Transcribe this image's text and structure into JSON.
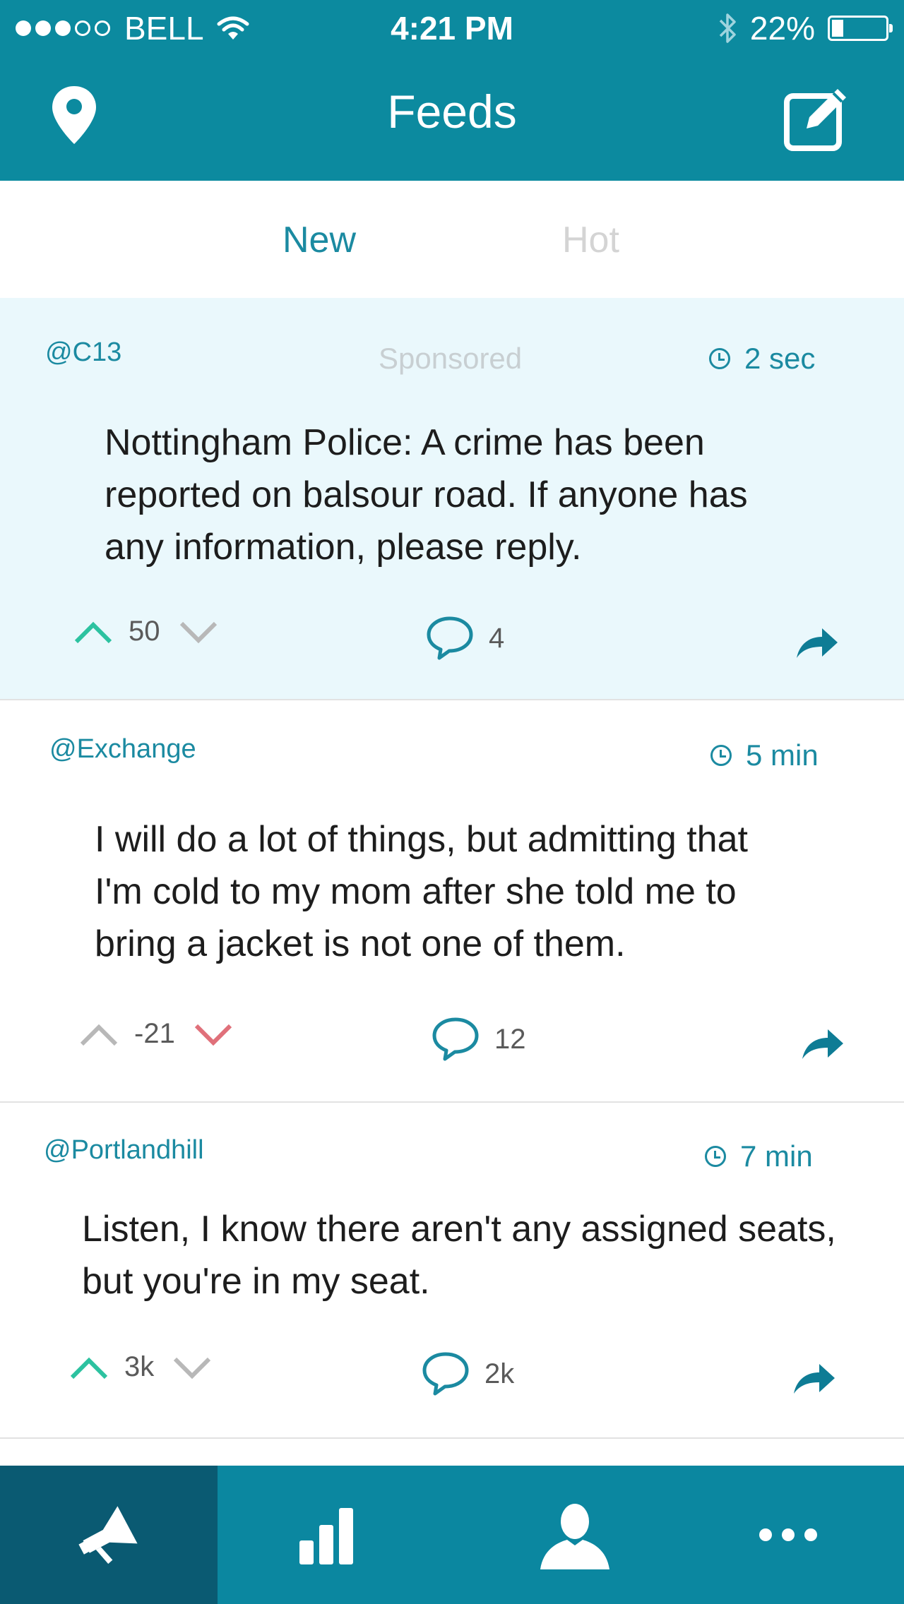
{
  "status_bar": {
    "carrier": "BELL",
    "time": "4:21 PM",
    "battery": "22%",
    "battery_fraction": 0.22
  },
  "header": {
    "title": "Feeds",
    "left_icon": "location-pin-icon",
    "right_icon": "compose-icon"
  },
  "tabs": [
    {
      "label": "New",
      "active": true
    },
    {
      "label": "Hot",
      "active": false
    }
  ],
  "posts": [
    {
      "handle": "@C13",
      "sponsored_label": "Sponsored",
      "time": "2 sec",
      "text_lines": [
        "Nottingham Police: A crime has been",
        "reported on balsour road. If anyone has",
        "any information, please reply."
      ],
      "votes": "50",
      "vote_state": "up",
      "comments": "4"
    },
    {
      "handle": "@Exchange",
      "time": "5 min",
      "text_lines": [
        "I will do a lot of things, but admitting that",
        "I'm cold to my mom after she told me to",
        "bring a jacket is not one of them."
      ],
      "votes": "-21",
      "vote_state": "down",
      "comments": "12"
    },
    {
      "handle": "@Portlandhill",
      "time": "7 min",
      "text_lines": [
        "Listen, I know there aren't any assigned seats,",
        "but you're in my seat."
      ],
      "votes": "3k",
      "vote_state": "up",
      "comments": "2k"
    }
  ],
  "colors": {
    "brand": "#0c8a9f",
    "upvote": "#2cc2a0",
    "downvote": "#e0707a",
    "neutral_vote": "#b8b8b8",
    "sponsored_bg": "#eaf8fc"
  },
  "tabbar": [
    {
      "icon": "megaphone-icon",
      "active": true
    },
    {
      "icon": "bar-chart-icon",
      "active": false
    },
    {
      "icon": "profile-icon",
      "active": false
    },
    {
      "icon": "more-icon",
      "active": false
    }
  ]
}
